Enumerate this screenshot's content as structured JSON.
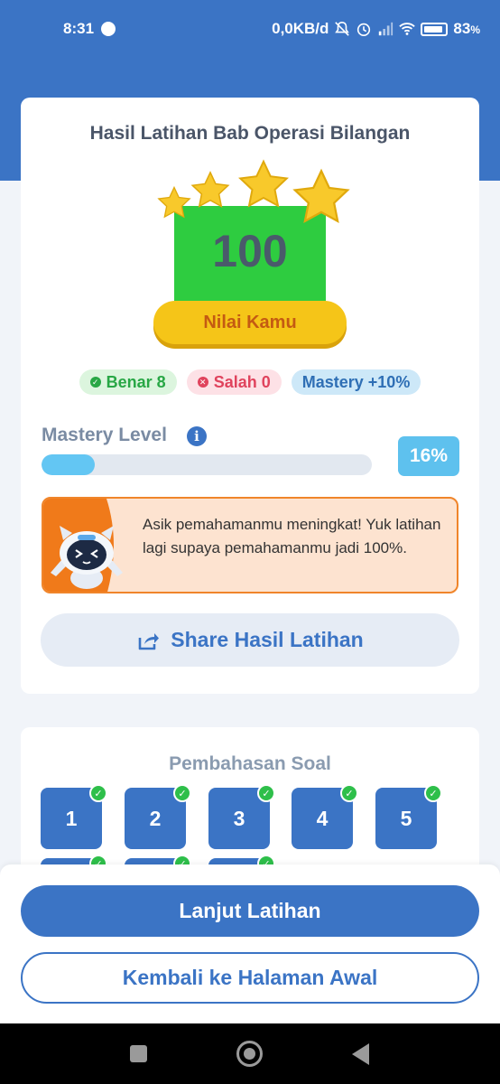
{
  "status_bar": {
    "time": "8:31",
    "network_speed": "0,0KB/d",
    "battery": "83",
    "battery_unit": "%"
  },
  "result": {
    "title": "Hasil Latihan Bab Operasi Bilangan",
    "score": "100",
    "score_label": "Nilai Kamu",
    "stars": 4
  },
  "chips": {
    "benar": "Benar 8",
    "salah": "Salah 0",
    "mastery": "Mastery +10%"
  },
  "mastery": {
    "label": "Mastery Level",
    "percent_text": "16%",
    "progress": 0.16
  },
  "message": {
    "text": "Asik pemahamanmu meningkat! Yuk latihan lagi supaya pemahamanmu jadi 100%."
  },
  "share_button": {
    "label": "Share Hasil Latihan"
  },
  "pembahasan": {
    "title": "Pembahasan Soal",
    "questions": [
      "1",
      "2",
      "3",
      "4",
      "5"
    ]
  },
  "actions": {
    "primary_label": "Lanjut Latihan",
    "secondary_label": "Kembali ke Halaman Awal"
  },
  "colors": {
    "primary": "#3b74c5",
    "score_bg": "#2ecc40",
    "ribbon": "#f5c518",
    "correct": "#28a745",
    "wrong": "#e0435d",
    "progress_fill": "#63c6f3",
    "message_border": "#f0852a"
  }
}
